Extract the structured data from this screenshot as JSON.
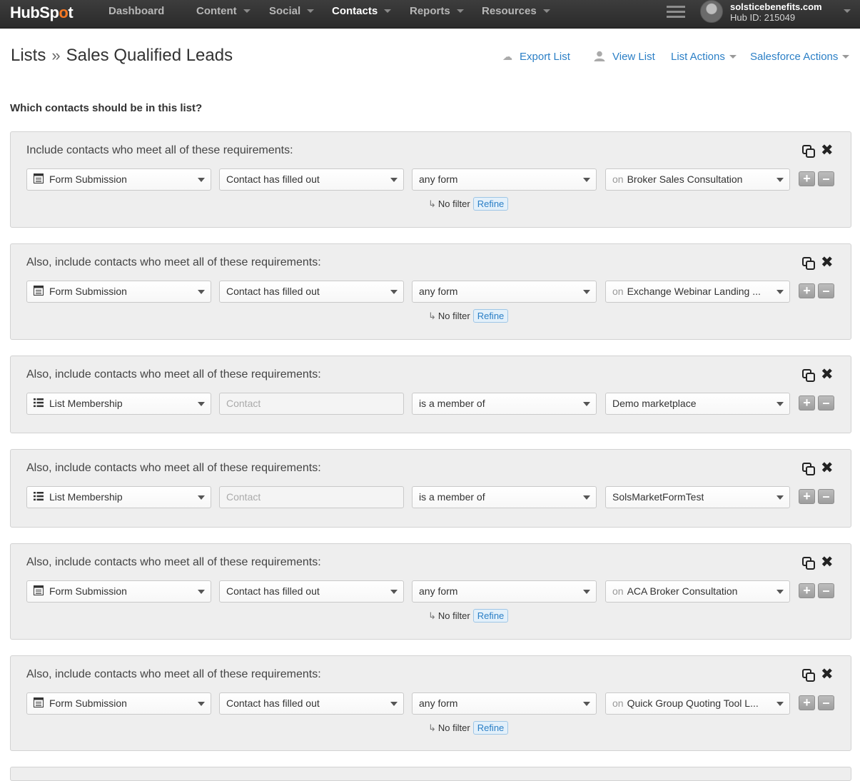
{
  "nav": {
    "logo": "HubSpot",
    "items": [
      {
        "label": "Dashboard",
        "caret": false,
        "active": false
      },
      {
        "label": "Content",
        "caret": true,
        "active": false
      },
      {
        "label": "Social",
        "caret": true,
        "active": false
      },
      {
        "label": "Contacts",
        "caret": true,
        "active": true
      },
      {
        "label": "Reports",
        "caret": true,
        "active": false
      },
      {
        "label": "Resources",
        "caret": true,
        "active": false
      }
    ],
    "account": {
      "domain": "solsticebenefits.com",
      "hub_id": "Hub ID: 215049"
    }
  },
  "header": {
    "breadcrumb_root": "Lists",
    "breadcrumb_sep": "»",
    "title": "Sales Qualified Leads",
    "actions": {
      "export": "Export List",
      "view": "View List",
      "list_actions": "List Actions",
      "salesforce_actions": "Salesforce Actions"
    }
  },
  "question": "Which contacts should be in this list?",
  "groups": [
    {
      "title": "Include contacts who meet all of these requirements:",
      "type": "Form Submission",
      "type_icon": "form-icon",
      "operator": "Contact has filled out",
      "operator_disabled": false,
      "condition": "any form",
      "value_prefix": "on",
      "value": "Broker Sales Consultation",
      "filter_text": "No filter",
      "refine": "Refine"
    },
    {
      "title": "Also, include contacts who meet all of these requirements:",
      "type": "Form Submission",
      "type_icon": "form-icon",
      "operator": "Contact has filled out",
      "operator_disabled": false,
      "condition": "any form",
      "value_prefix": "on",
      "value": "Exchange Webinar Landing ...",
      "filter_text": "No filter",
      "refine": "Refine"
    },
    {
      "title": "Also, include contacts who meet all of these requirements:",
      "type": "List Membership",
      "type_icon": "list-icon",
      "operator": "Contact",
      "operator_disabled": true,
      "condition": "is a member of",
      "value_prefix": "",
      "value": "Demo marketplace",
      "filter_text": "",
      "refine": ""
    },
    {
      "title": "Also, include contacts who meet all of these requirements:",
      "type": "List Membership",
      "type_icon": "list-icon",
      "operator": "Contact",
      "operator_disabled": true,
      "condition": "is a member of",
      "value_prefix": "",
      "value": "SolsMarketFormTest",
      "filter_text": "",
      "refine": ""
    },
    {
      "title": "Also, include contacts who meet all of these requirements:",
      "type": "Form Submission",
      "type_icon": "form-icon",
      "operator": "Contact has filled out",
      "operator_disabled": false,
      "condition": "any form",
      "value_prefix": "on",
      "value": "ACA Broker Consultation",
      "filter_text": "No filter",
      "refine": "Refine"
    },
    {
      "title": "Also, include contacts who meet all of these requirements:",
      "type": "Form Submission",
      "type_icon": "form-icon",
      "operator": "Contact has filled out",
      "operator_disabled": false,
      "condition": "any form",
      "value_prefix": "on",
      "value": "Quick Group Quoting Tool L...",
      "filter_text": "No filter",
      "refine": "Refine"
    }
  ],
  "colors": {
    "accent": "#2b7fc6",
    "nav_bg": "#333333",
    "brand": "#f57722",
    "group_bg": "#eeeeee"
  }
}
